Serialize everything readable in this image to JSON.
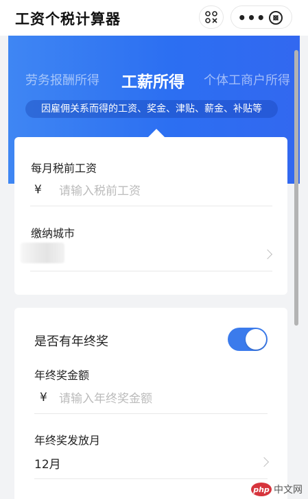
{
  "app": {
    "title": "工资个税计算器"
  },
  "capsule": {
    "menu_icon": "more-dots-icon",
    "close_icon": "close-circle-icon",
    "scan_icon": "scan-icon",
    "menu_glyph": "•••"
  },
  "tabs": [
    {
      "label": "劳务报酬所得",
      "active": false
    },
    {
      "label": "工薪所得",
      "active": true
    },
    {
      "label": "个体工商户所得",
      "active": false
    }
  ],
  "tab_description": "因雇佣关系而得的工资、奖金、津贴、薪金、补贴等",
  "salary_card": {
    "monthly_label": "每月税前工资",
    "currency": "¥",
    "monthly_placeholder": "请输入税前工资",
    "city_label": "缴纳城市",
    "city_value": ""
  },
  "bonus_card": {
    "has_bonus_label": "是否有年终奖",
    "has_bonus": true,
    "amount_label": "年终奖金额",
    "currency": "¥",
    "amount_placeholder": "请输入年终奖金额",
    "month_label": "年终奖发放月",
    "month_value": "12月"
  },
  "watermark": {
    "logo": "php",
    "text": "中文网"
  },
  "colors": {
    "accent": "#2c6ff2",
    "toggle_on": "#3b7bec",
    "background": "#f2f3f5"
  }
}
